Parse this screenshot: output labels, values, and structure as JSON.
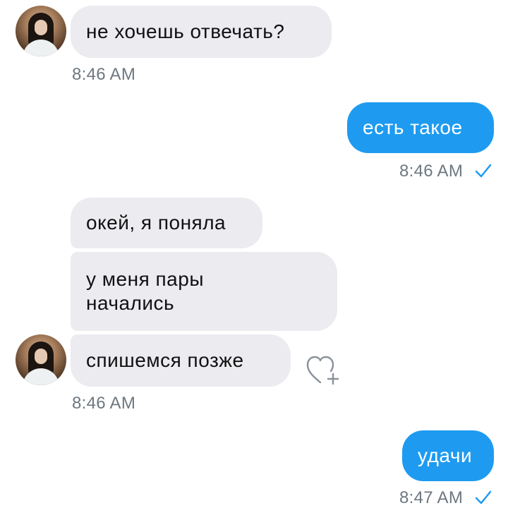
{
  "messages": [
    {
      "direction": "incoming",
      "text": "не хочешь отвечать?",
      "time": "8:46 AM"
    },
    {
      "direction": "outgoing",
      "text": "есть такое",
      "time": "8:46 AM"
    },
    {
      "direction": "incoming",
      "text": "окей, я поняла"
    },
    {
      "direction": "incoming",
      "text": "у меня пары\nначались"
    },
    {
      "direction": "incoming",
      "text": "спишемся позже",
      "time": "8:46 AM"
    },
    {
      "direction": "outgoing",
      "text": "удачи",
      "time": "8:47 AM"
    }
  ],
  "icons": {
    "avatar": "avatar",
    "read_receipt": "check-icon",
    "react": "heart-add-icon"
  },
  "colors": {
    "incoming_bubble": "#ebebf0",
    "outgoing_bubble": "#1e9bf0",
    "timestamp": "#6e7780",
    "check": "#1e9bf0"
  }
}
